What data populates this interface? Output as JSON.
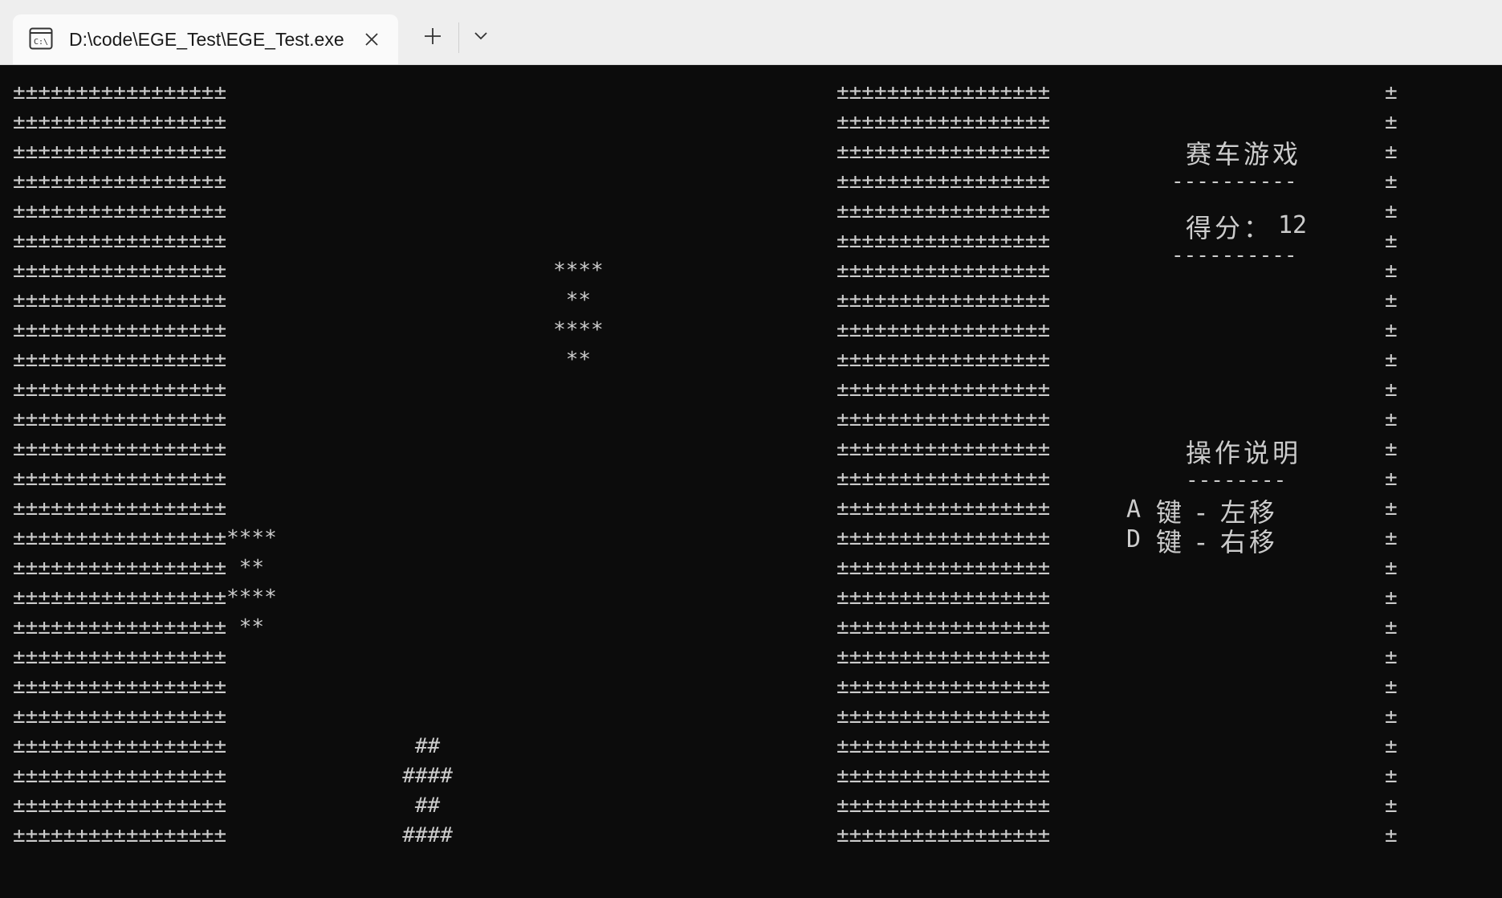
{
  "window": {
    "tab_title": "D:\\code\\EGE_Test\\EGE_Test.exe",
    "tab_icon": "terminal-icon",
    "close_icon": "close-icon",
    "new_tab_icon": "plus-icon",
    "dropdown_icon": "chevron-down-icon"
  },
  "game": {
    "left_wall_rows": [
      "±±±±±±±±±±±±±±±±±",
      "±±±±±±±±±±±±±±±±±",
      "±±±±±±±±±±±±±±±±±",
      "±±±±±±±±±±±±±±±±±",
      "±±±±±±±±±±±±±±±±±",
      "±±±±±±±±±±±±±±±±±",
      "±±±±±±±±±±±±±±±±±",
      "±±±±±±±±±±±±±±±±±",
      "±±±±±±±±±±±±±±±±±",
      "±±±±±±±±±±±±±±±±±",
      "±±±±±±±±±±±±±±±±±",
      "±±±±±±±±±±±±±±±±±",
      "±±±±±±±±±±±±±±±±±",
      "±±±±±±±±±±±±±±±±±",
      "±±±±±±±±±±±±±±±±±",
      "±±±±±±±±±±±±±±±±±****",
      "±±±±±±±±±±±±±±±±± **",
      "±±±±±±±±±±±±±±±±±****",
      "±±±±±±±±±±±±±±±±± **",
      "±±±±±±±±±±±±±±±±±",
      "±±±±±±±±±±±±±±±±±",
      "±±±±±±±±±±±±±±±±±",
      "±±±±±±±±±±±±±±±±±",
      "±±±±±±±±±±±±±±±±±",
      "±±±±±±±±±±±±±±±±±",
      "±±±±±±±±±±±±±±±±±"
    ],
    "road_rows": [
      "",
      "",
      "",
      "",
      "",
      "",
      "                                           ****",
      "                                            **",
      "                                           ****",
      "                                            **",
      "",
      "",
      "",
      "",
      "",
      "",
      "",
      "",
      "",
      "",
      "",
      "",
      "                                ##",
      "                               ####",
      "                                ##",
      "                               ####"
    ],
    "right_wall_rows": [
      "±±±±±±±±±±±±±±±±±",
      "±±±±±±±±±±±±±±±±±",
      "±±±±±±±±±±±±±±±±±",
      "±±±±±±±±±±±±±±±±±",
      "±±±±±±±±±±±±±±±±±",
      "±±±±±±±±±±±±±±±±±",
      "±±±±±±±±±±±±±±±±±",
      "±±±±±±±±±±±±±±±±±",
      "±±±±±±±±±±±±±±±±±",
      "±±±±±±±±±±±±±±±±±",
      "±±±±±±±±±±±±±±±±±",
      "±±±±±±±±±±±±±±±±±",
      "±±±±±±±±±±±±±±±±±",
      "±±±±±±±±±±±±±±±±±",
      "±±±±±±±±±±±±±±±±±",
      "±±±±±±±±±±±±±±±±±",
      "±±±±±±±±±±±±±±±±±",
      "±±±±±±±±±±±±±±±±±",
      "±±±±±±±±±±±±±±±±±",
      "±±±±±±±±±±±±±±±±±",
      "±±±±±±±±±±±±±±±±±",
      "±±±±±±±±±±±±±±±±±",
      "±±±±±±±±±±±±±±±±±",
      "±±±±±±±±±±±±±±±±±",
      "±±±±±±±±±±±±±±±±±",
      "±±±±±±±±±±±±±±±±±"
    ],
    "border_rows": [
      "±",
      "±",
      "±",
      "±",
      "±",
      "±",
      "±",
      "±",
      "±",
      "±",
      "±",
      "±",
      "±",
      "±",
      "±",
      "±",
      "±",
      "±",
      "±",
      "±",
      "±",
      "±",
      "±",
      "±",
      "±",
      "±"
    ]
  },
  "panel": {
    "title": "赛车游戏",
    "divider_top": "----------",
    "score_label": "得分：",
    "score_value": "12",
    "divider_bottom": "----------",
    "controls_title": "操作说明",
    "controls_divider": "--------",
    "control_a_key": "A",
    "control_a_text": "键 - 左移",
    "control_d_key": "D",
    "control_d_text": "键 - 右移"
  }
}
